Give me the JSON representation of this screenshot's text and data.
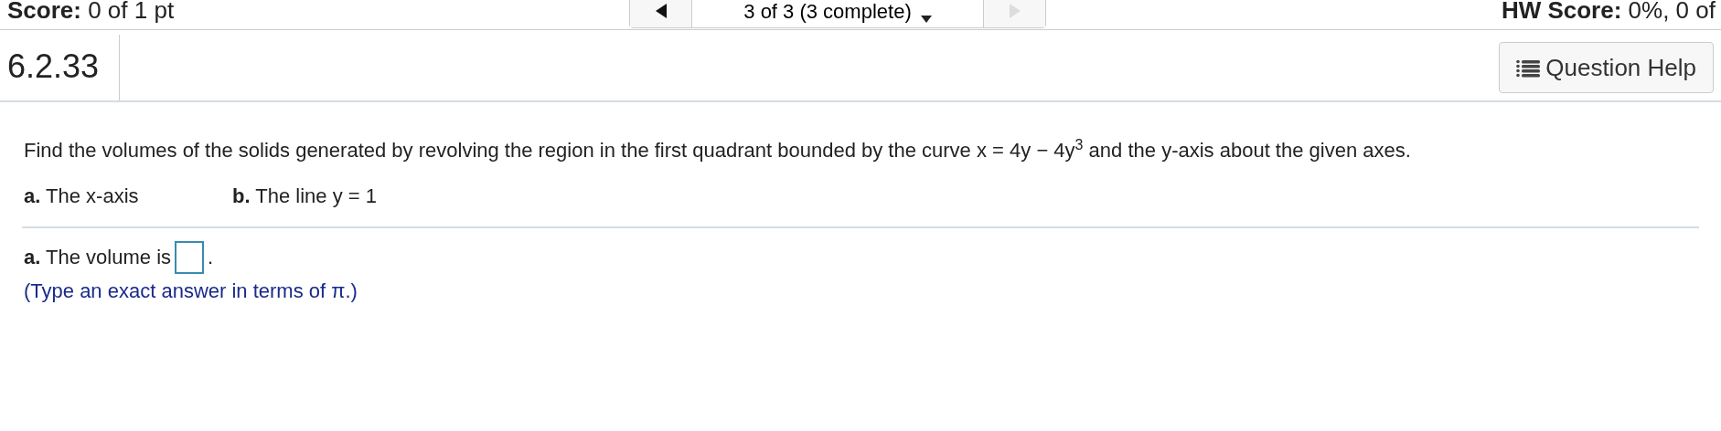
{
  "top_bar": {
    "score": "**Score:** 0 of 1 pt",
    "navigator": {
      "label": "3 of 3 (3 complete)",
      "previous": {
        "disabled": false
      },
      "next": {
        "disabled": true
      }
    },
    "hw_score": "**HW Score:** 0%, 0 of"
  },
  "question": {
    "number": "6.2.33",
    "help_button": "Question Help",
    "prompt": "Find the volumes of the solids generated by revolving the region in the first quadrant bounded by the curve x = 4y − 4y$^{3}$ and the y-axis about the given axes.",
    "parts": [
      {
        "text": "**a.** The x-axis"
      },
      {
        "text": "**b.** The line y = 1"
      }
    ]
  },
  "answer": {
    "label": "**a.** The volume is",
    "after": ".",
    "hint": "(Type an exact answer in terms of π.)"
  }
}
